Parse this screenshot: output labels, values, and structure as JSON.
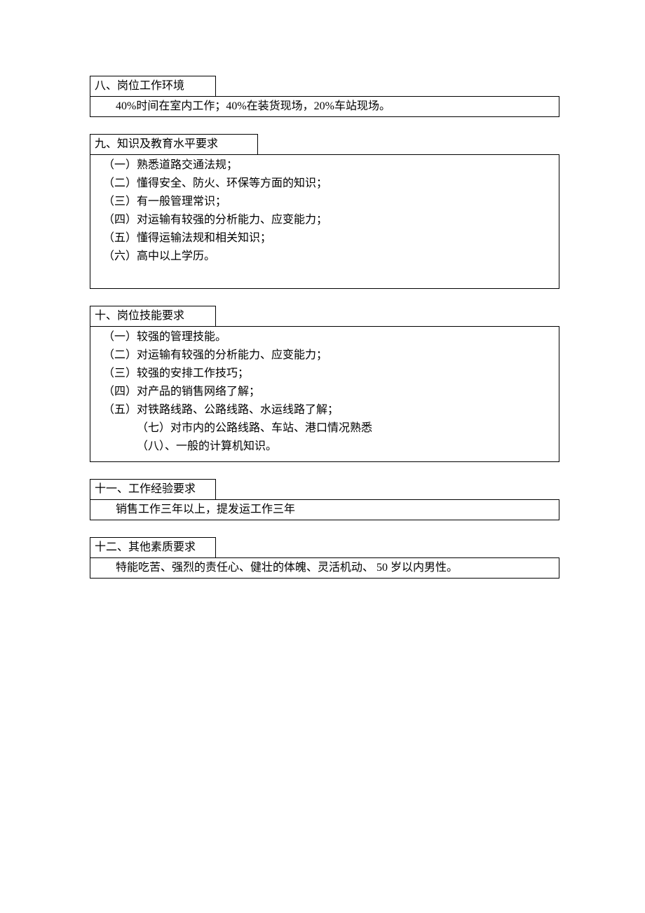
{
  "sections": {
    "s8": {
      "header": "八、岗位工作环境",
      "body": "40%时间在室内工作；40%在装货现场，20%车站现场。"
    },
    "s9": {
      "header": "九、知识及教育水平要求",
      "items": [
        "（一）熟悉道路交通法规；",
        "（二）懂得安全、防火、环保等方面的知识；",
        "（三）有一般管理常识；",
        "（四）对运输有较强的分析能力、应变能力；",
        "（五）懂得运输法规和相关知识；",
        "（六）高中以上学历。"
      ]
    },
    "s10": {
      "header": "十、岗位技能要求",
      "items": [
        "（一）较强的管理技能。",
        "（二）对运输有较强的分析能力、应变能力；",
        "（三）较强的安排工作技巧；",
        "（四）对产品的销售网络了解；",
        "（五）对铁路线路、公路线路、水运线路了解；"
      ],
      "indent_items": [
        "（七）对市内的公路线路、车站、港口情况熟悉",
        "（八）、一般的计算机知识。"
      ]
    },
    "s11": {
      "header": "十一、工作经验要求",
      "body": "销售工作三年以上，提发运工作三年"
    },
    "s12": {
      "header": "十二、其他素质要求",
      "body": "特能吃苦、强烈的责任心、健壮的体魄、灵活机动、 50 岁以内男性。"
    }
  }
}
